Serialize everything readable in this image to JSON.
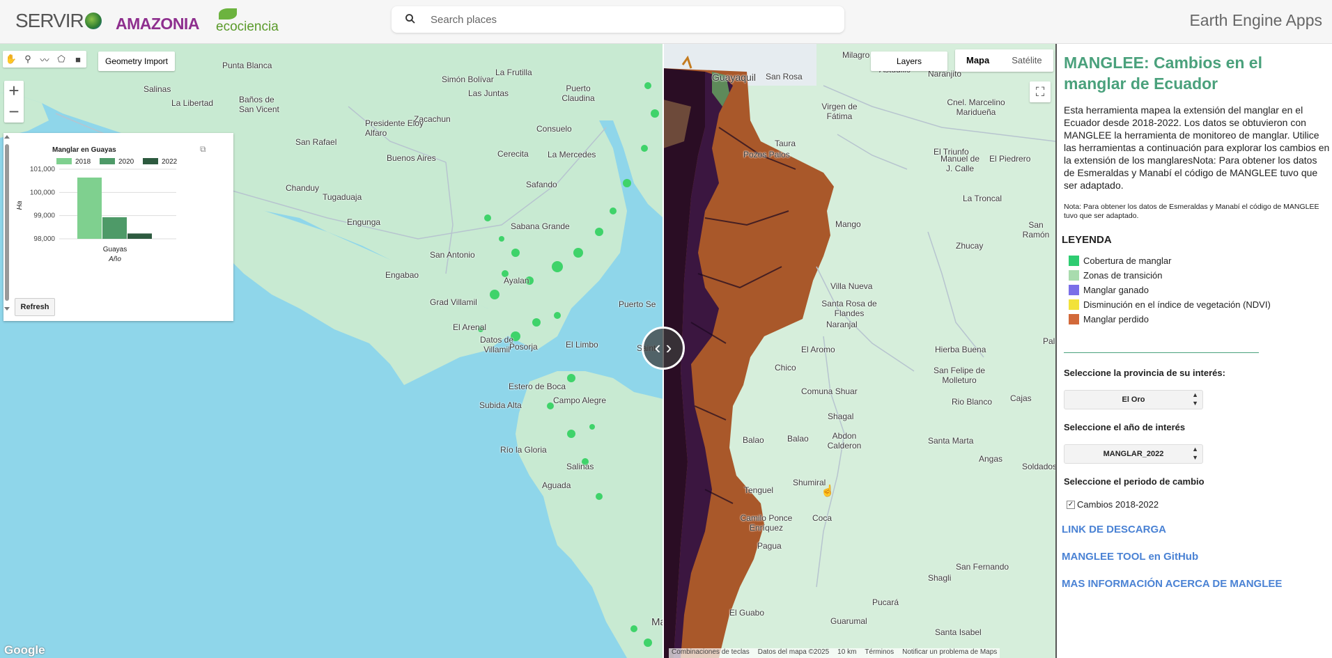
{
  "header": {
    "logo_servir": "SERVIR",
    "logo_amazonia": "AMAZONIA",
    "logo_eco": "ecociencia",
    "search_placeholder": "Search places",
    "app_title": "Earth Engine Apps"
  },
  "map_controls": {
    "geometry_import": "Geometry Import",
    "zoom_in": "+",
    "zoom_out": "−",
    "layers": "Layers",
    "map_type_map": "Mapa",
    "map_type_satellite": "Satélite",
    "google": "Google",
    "attribution": [
      "Combinaciones de teclas",
      "Datos del mapa ©2025",
      "10 km",
      "Términos",
      "Notificar un problema de Maps"
    ]
  },
  "places_left": [
    "Punta Blanca",
    "Salinas",
    "La Libertad",
    "Baños de San Vicent",
    "Simón Bolívar",
    "La Frutilla",
    "Las Juntas",
    "Puerto Claudina",
    "Zacachun",
    "Consuelo",
    "San Rafael",
    "Presidente Eloy Alfaro",
    "Buenos Aires",
    "Cerecita",
    "La Mercedes",
    "Chanduy",
    "Tugaduaja",
    "Safando",
    "Engunga",
    "Sabana Grande",
    "San Antonio",
    "Engabao",
    "Ayalan",
    "Grad Villamil",
    "Puerto Se",
    "El Arenal",
    "Datos de Villamil",
    "Posorja",
    "El Limbo",
    "Saint",
    "Estero de Boca",
    "Subida Alta",
    "Campo Alegre",
    "Río la Gloria",
    "Salinas",
    "Aguada",
    "Ma"
  ],
  "places_right": [
    "Milagro",
    "Roberto Astudillo",
    "Naranjito",
    "San Rosa",
    "Virgen de Fátima",
    "Cnel. Marcelino Maridueña",
    "Taura",
    "Pozos Palos",
    "El Triunfo",
    "Manuel de J. Calle",
    "El Piedrero",
    "La Troncal",
    "Mango",
    "San Ramón",
    "Zhucay",
    "Villa Nueva",
    "Santa Rosa de Flandes",
    "Naranjal",
    "El Aromo",
    "Hierba Buena",
    "San Felipe de Molleturo",
    "Comuna Shuar",
    "Rio Blanco",
    "Cajas",
    "Shagal",
    "Abdon Calderon",
    "Santa Marta",
    "Balao",
    "Angas",
    "Soldados",
    "Tenguel",
    "Shumiral",
    "Camilo Ponce Enríquez",
    "Coca",
    "Pagua",
    "San Fernando",
    "Shagli",
    "Pucará",
    "El Guabo",
    "Guarumal",
    "Santa Isabel",
    "Guayaquil",
    "Chico",
    "Balao",
    "Pal"
  ],
  "chart_panel": {
    "title": "Manglar en Guayas",
    "refresh": "Refresh",
    "chart_data": {
      "type": "bar",
      "title": "Manglar en Guayas",
      "xlabel": "Año",
      "ylabel": "Ha",
      "categories": [
        "Guayas"
      ],
      "series": [
        {
          "name": "2018",
          "color": "#7fd08f",
          "values": [
            100640
          ]
        },
        {
          "name": "2020",
          "color": "#4e9a68",
          "values": [
            98930
          ]
        },
        {
          "name": "2022",
          "color": "#2d5a3f",
          "values": [
            98230
          ]
        }
      ],
      "ylim": [
        98000,
        101000
      ],
      "yticks": [
        98000,
        99000,
        100000,
        101000
      ],
      "ytick_labels": [
        "98,000",
        "99,000",
        "100,000",
        "101,000"
      ],
      "legend_position": "top"
    }
  },
  "side": {
    "title": "MANGLEE: Cambios en el manglar de Ecuador",
    "description": "Esta herramienta mapea la extensión del manglar en el Ecuador desde 2018-2022. Los datos se obtuvieron con MANGLEE la herramienta de monitoreo de manglar. Utilice las herramientas a continuación para explorar los cambios en la extensión de los manglaresNota: Para obtener los datos de Esmeraldas y Manabí el código de MANGLEE tuvo que ser adaptado.",
    "note": "Nota: Para obtener los datos de Esmeraldas y Manabí el código de MANGLEE tuvo que ser adaptado.",
    "legend_title": "LEYENDA",
    "legend": [
      {
        "label": "Cobertura de manglar",
        "color": "#2ecc71"
      },
      {
        "label": "Zonas de transición",
        "color": "#a9dcae"
      },
      {
        "label": "Manglar ganado",
        "color": "#7a6fe8"
      },
      {
        "label": "Disminución en el índice de vegetación (NDVI)",
        "color": "#f2e23a"
      },
      {
        "label": "Manglar perdido",
        "color": "#d2693a"
      }
    ],
    "province_label": "Seleccione la provincia de su interés:",
    "province_value": "El Oro",
    "year_label": "Seleccione el año de interés",
    "year_value": "MANGLAR_2022",
    "period_label": "Seleccione el periodo de cambio",
    "period_checkbox": "Cambios 2018-2022",
    "links": [
      "LINK DE DESCARGA",
      "MANGLEE TOOL en GitHub",
      "MAS INFORMACIÓN ACERCA DE MANGLEE"
    ]
  }
}
